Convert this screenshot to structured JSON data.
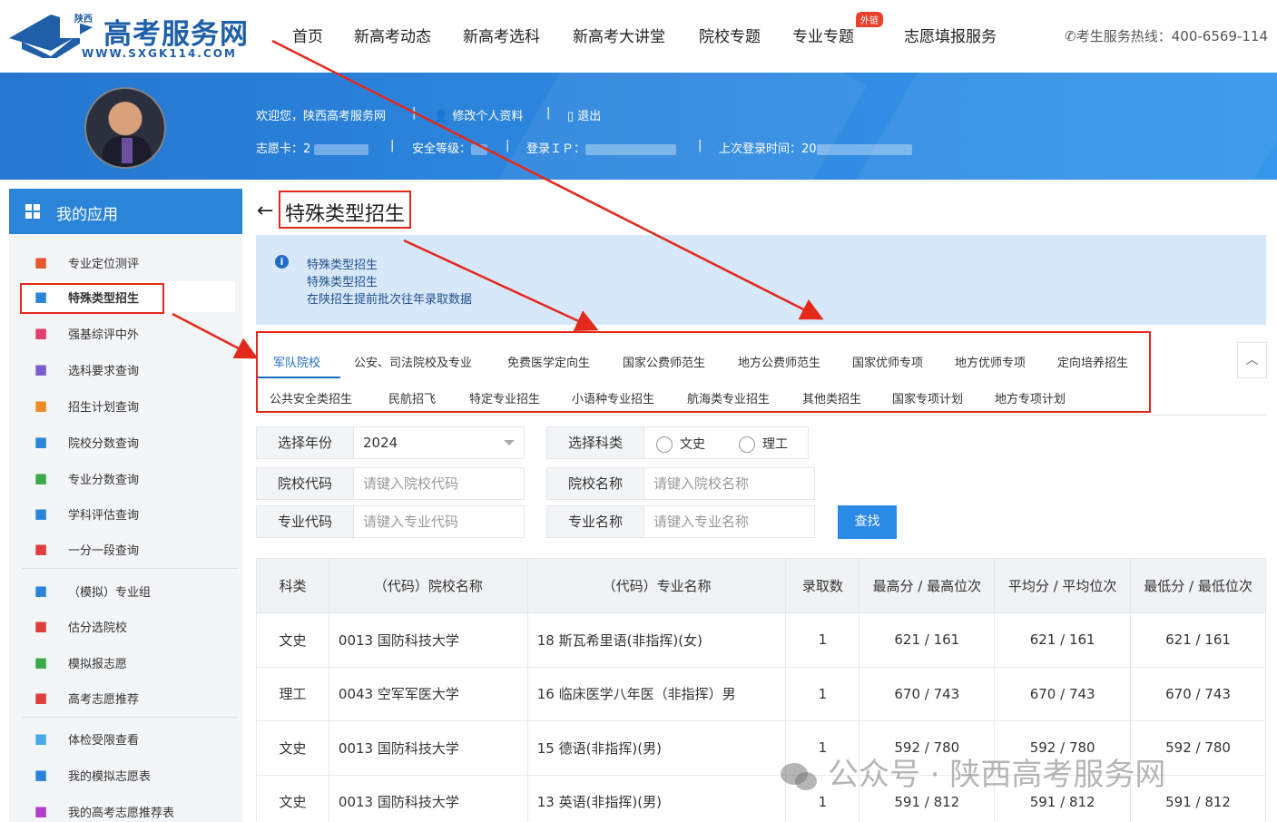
{
  "brand": {
    "province": "陕西",
    "name": "高考服务网",
    "url": "WWW.SXGK114.COM"
  },
  "nav": {
    "items": [
      "首页",
      "新高考动态",
      "新高考选科",
      "新高考大讲堂",
      "院校专题",
      "专业专题",
      "志愿填报服务"
    ],
    "badge": "外链",
    "hotline": "考生服务热线：400-6569-114"
  },
  "user": {
    "welcome": "欢迎您，陕西高考服务网",
    "edit_profile": "修改个人资料",
    "logout": "退出",
    "card_label": "志愿卡：2",
    "security_label": "安全等级：",
    "ip_label": "登录ＩＰ：",
    "last_login_label": "上次登录时间：20"
  },
  "sidebar": {
    "title": "我的应用",
    "items": [
      {
        "label": "专业定位测评",
        "icon": "clipboard-icon",
        "color": "#e8572f"
      },
      {
        "label": "特殊类型招生",
        "icon": "school-icon",
        "color": "#2a85d9"
      },
      {
        "label": "强基综评中外",
        "icon": "umbrella-icon",
        "color": "#e23d6c"
      },
      {
        "label": "选科要求查询",
        "icon": "box-icon",
        "color": "#7b5fd0"
      },
      {
        "label": "招生计划查询",
        "icon": "person-search-icon",
        "color": "#f08a24"
      },
      {
        "label": "院校分数查询",
        "icon": "bank-icon",
        "color": "#2a85d9"
      },
      {
        "label": "专业分数查询",
        "icon": "books-icon",
        "color": "#3bab4a"
      },
      {
        "label": "学科评估查询",
        "icon": "doc-a-icon",
        "color": "#2a85d9"
      },
      {
        "label": "一分一段查询",
        "icon": "bar-chart-icon",
        "color": "#e23d3d"
      },
      {
        "label": "（模拟）专业组",
        "icon": "line-chart-icon",
        "color": "#2a85d9"
      },
      {
        "label": "估分选院校",
        "icon": "pen-icon",
        "color": "#e23d3d"
      },
      {
        "label": "模拟报志愿",
        "icon": "leaf-icon",
        "color": "#3bab4a"
      },
      {
        "label": "高考志愿推荐",
        "icon": "trend-icon",
        "color": "#e23d3d"
      },
      {
        "label": "体检受限查看",
        "icon": "heart-icon",
        "color": "#4aa8e8"
      },
      {
        "label": "我的模拟志愿表",
        "icon": "table-icon",
        "color": "#2a85d9"
      },
      {
        "label": "我的高考志愿推荐表",
        "icon": "table2-icon",
        "color": "#b03dcc"
      }
    ]
  },
  "main": {
    "back": "←",
    "title": "特殊类型招生",
    "info_lines": [
      "特殊类型招生",
      "特殊类型招生",
      "在陕招生提前批次往年录取数据"
    ],
    "tabs_row1": [
      "军队院校",
      "公安、司法院校及专业",
      "免费医学定向生",
      "国家公费师范生",
      "地方公费师范生",
      "国家优师专项",
      "地方优师专项",
      "定向培养招生"
    ],
    "tabs_row2": [
      "公共安全类招生",
      "民航招飞",
      "特定专业招生",
      "小语种专业招生",
      "航海类专业招生",
      "其他类招生",
      "国家专项计划",
      "地方专项计划"
    ],
    "collapse": "︿"
  },
  "filters": {
    "year_label": "选择年份",
    "year_value": "2024",
    "subject_label": "选择科类",
    "subject_options": [
      "文史",
      "理工"
    ],
    "school_code_label": "院校代码",
    "school_code_placeholder": "请键入院校代码",
    "school_name_label": "院校名称",
    "school_name_placeholder": "请键入院校名称",
    "major_code_label": "专业代码",
    "major_code_placeholder": "请键入专业代码",
    "major_name_label": "专业名称",
    "major_name_placeholder": "请键入专业名称",
    "search_button": "查找"
  },
  "table": {
    "headers": [
      "科类",
      "（代码）院校名称",
      "（代码）专业名称",
      "录取数",
      "最高分 / 最高位次",
      "平均分 / 平均位次",
      "最低分 / 最低位次"
    ],
    "rows": [
      [
        "文史",
        "0013 国防科技大学",
        "18 斯瓦希里语(非指挥)(女)",
        "1",
        "621 / 161",
        "621 / 161",
        "621 / 161"
      ],
      [
        "理工",
        "0043 空军军医大学",
        "16 临床医学八年医（非指挥）男",
        "1",
        "670 / 743",
        "670 / 743",
        "670 / 743"
      ],
      [
        "文史",
        "0013 国防科技大学",
        "15 德语(非指挥)(男)",
        "1",
        "592 / 780",
        "592 / 780",
        "592 / 780"
      ],
      [
        "文史",
        "0013 国防科技大学",
        "13 英语(非指挥)(男)",
        "1",
        "591 / 812",
        "591 / 812",
        "591 / 812"
      ]
    ]
  },
  "watermark": "公众号 · 陕西高考服务网",
  "colors": {
    "brand_blue": "#1f5fa8",
    "accent_blue": "#2a85d9",
    "annotation_red": "#e3291c"
  }
}
